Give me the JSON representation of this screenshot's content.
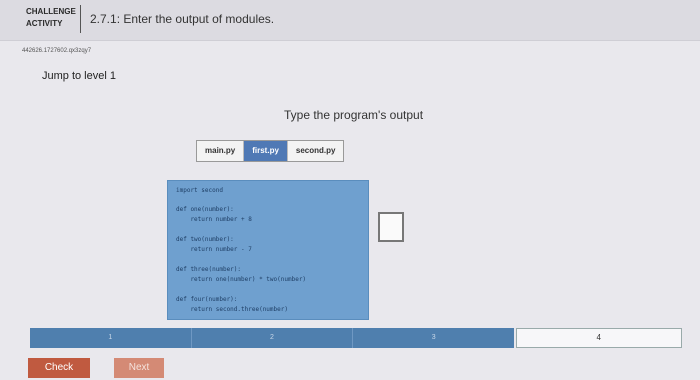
{
  "header": {
    "badge_line1": "CHALLENGE",
    "badge_line2": "ACTIVITY",
    "title": "2.7.1: Enter the output of modules."
  },
  "activity_id": "442626.1727602.qx3zqy7",
  "jump_link": "Jump to level 1",
  "prompt": "Type the program's output",
  "tabs": [
    {
      "label": "main.py",
      "active": false
    },
    {
      "label": "first.py",
      "active": true
    },
    {
      "label": "second.py",
      "active": false
    }
  ],
  "code": {
    "lines": [
      "import second",
      "def one(number):",
      "    return number + 8",
      "def two(number):",
      "    return number - 7",
      "def three(number):",
      "    return one(number) * two(number)",
      "def four(number):",
      "    return second.three(number)"
    ]
  },
  "answer": {
    "value": ""
  },
  "levels": {
    "segments": [
      "1",
      "2",
      "3"
    ],
    "current": "4"
  },
  "buttons": {
    "check": "Check",
    "next": "Next"
  },
  "colors": {
    "accent": "#4f79b5",
    "code_bg": "#6fa0cf",
    "check_button": "#c05a40",
    "next_button": "#d48a75"
  }
}
